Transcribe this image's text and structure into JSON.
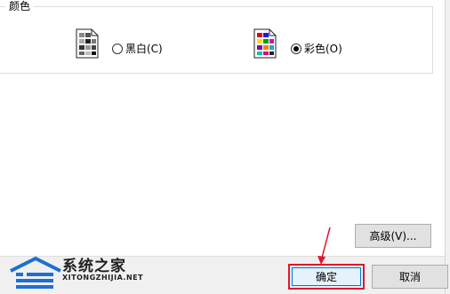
{
  "group": {
    "title": "颜色"
  },
  "options": {
    "mono": {
      "label": "黑白(C)",
      "checked": false
    },
    "color": {
      "label": "彩色(O)",
      "checked": true
    }
  },
  "buttons": {
    "advanced": "高级(V)...",
    "ok": "确定",
    "cancel": "取消"
  },
  "watermark": {
    "name": "系统之家",
    "url": "XITONGZHIJIA.NET"
  },
  "colors": {
    "highlight": "#e0182b",
    "focus": "#0078d7"
  },
  "icons": [
    "mono-document-icon",
    "color-document-icon",
    "watermark-logo-icon",
    "annotation-arrow-icon"
  ]
}
